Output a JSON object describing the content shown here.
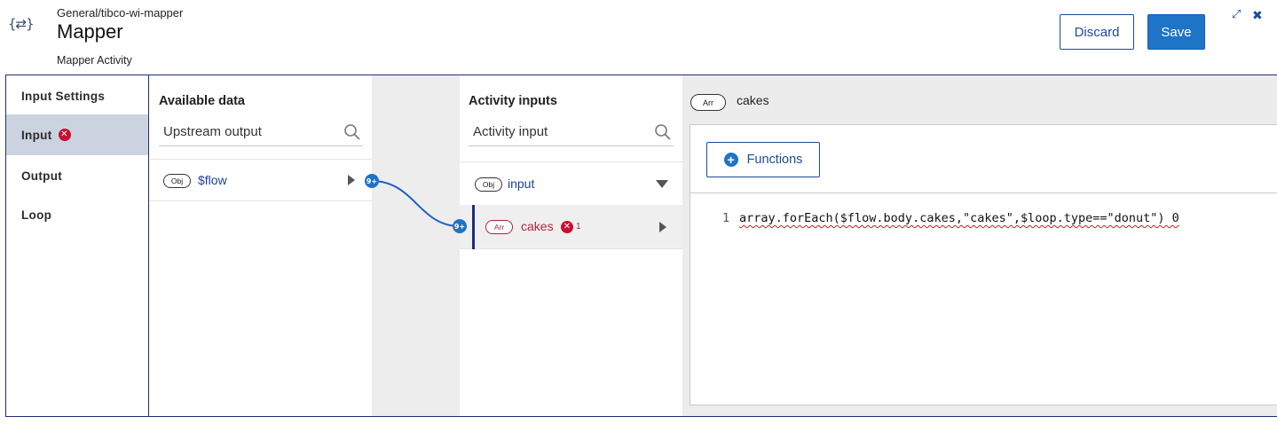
{
  "header": {
    "icon": "{⇄}",
    "breadcrumb": "General/tibco-wi-mapper",
    "title": "Mapper",
    "subtitle": "Mapper Activity",
    "discard_label": "Discard",
    "save_label": "Save",
    "expand_icon": "⤢",
    "close_icon": "✖"
  },
  "tabs": [
    {
      "label": "Input Settings",
      "active": false,
      "error": false
    },
    {
      "label": "Input",
      "active": true,
      "error": true
    },
    {
      "label": "Output",
      "active": false,
      "error": false
    },
    {
      "label": "Loop",
      "active": false,
      "error": false
    }
  ],
  "available": {
    "title": "Available data",
    "search_placeholder": "Upstream output",
    "items": [
      {
        "type": "Obj",
        "name": "$flow"
      }
    ]
  },
  "activity": {
    "title": "Activity inputs",
    "search_placeholder": "Activity input",
    "items": [
      {
        "type": "Obj",
        "name": "input"
      },
      {
        "type": "Arr",
        "name": "cakes",
        "error_count": "1"
      }
    ]
  },
  "connector": {
    "node_label": "9+"
  },
  "editor": {
    "field_type": "Arr",
    "field_name": "cakes",
    "functions_label": "Functions",
    "line_number": "1",
    "code": "array.forEach($flow.body.cakes,\"cakes\",$loop.type==\"donut\") 0"
  },
  "colors": {
    "accent": "#1e74c6",
    "frame": "#1f2d7a",
    "error": "#c8102e",
    "active_tab": "#ccd3e0"
  }
}
